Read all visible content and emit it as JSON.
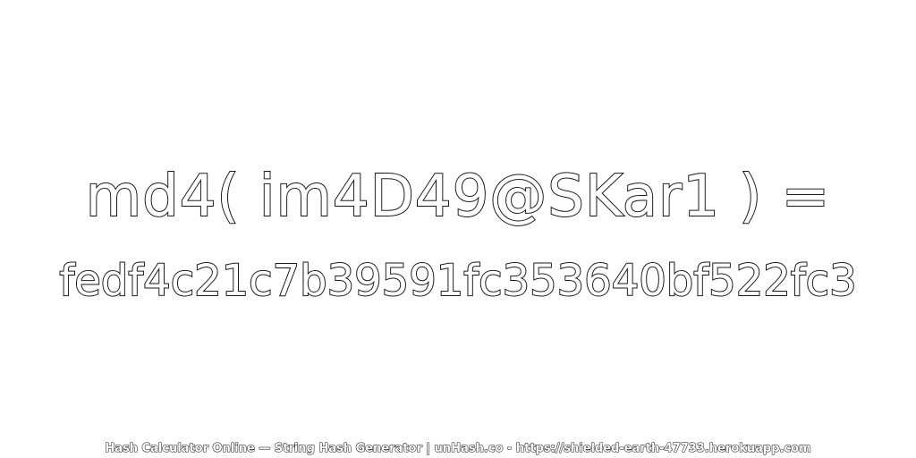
{
  "expression": "md4( im4D49@SKar1 ) =",
  "hash": "fedf4c21c7b39591fc353640bf522fc3",
  "footer": "Hash Calculator Online — String Hash Generator | unHash.co - https://shielded-earth-47733.herokuapp.com",
  "colors": {
    "background": "#ffffff",
    "text_fill": "#ffffff",
    "text_outline": "#1a1a1a"
  }
}
